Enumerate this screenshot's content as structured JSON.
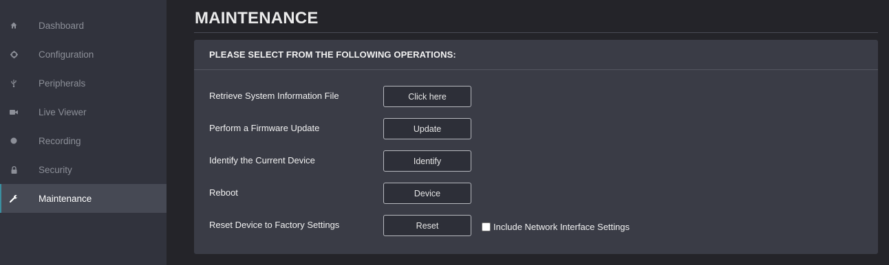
{
  "sidebar": {
    "items": [
      {
        "label": "Dashboard",
        "icon": "home-icon"
      },
      {
        "label": "Configuration",
        "icon": "gear-icon"
      },
      {
        "label": "Peripherals",
        "icon": "usb-icon"
      },
      {
        "label": "Live Viewer",
        "icon": "video-camera-icon"
      },
      {
        "label": "Recording",
        "icon": "record-dot-icon"
      },
      {
        "label": "Security",
        "icon": "lock-icon"
      },
      {
        "label": "Maintenance",
        "icon": "wrench-icon",
        "active": true
      }
    ],
    "accent_color": "#3b8fa0"
  },
  "main": {
    "title": "MAINTENANCE",
    "panel": {
      "header": "PLEASE SELECT FROM THE FOLLOWING OPERATIONS:",
      "operations": [
        {
          "label": "Retrieve System Information File",
          "button": "Click here"
        },
        {
          "label": "Perform a Firmware Update",
          "button": "Update"
        },
        {
          "label": "Identify the Current Device",
          "button": "Identify"
        },
        {
          "label": "Reboot",
          "button": "Device"
        },
        {
          "label": "Reset Device to Factory Settings",
          "button": "Reset"
        }
      ],
      "reset_option": {
        "label": "Include Network Interface Settings",
        "checked": false
      }
    }
  }
}
